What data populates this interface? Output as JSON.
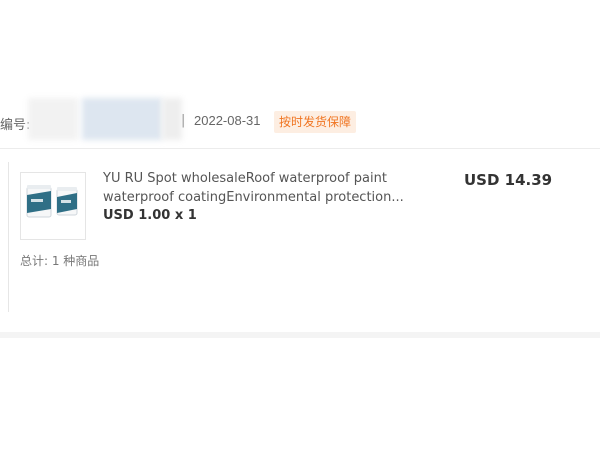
{
  "order": {
    "number_label": "编号:",
    "separator": "|",
    "date": "2022-08-31",
    "badge": "按时发货保障",
    "total": "USD 14.39",
    "items_count": "总计: 1 种商品"
  },
  "product": {
    "title": "YU RU Spot wholesaleRoof waterproof paint waterproof coatingEnvironmental protection...",
    "price_qty": "USD 1.00 x 1",
    "thumb_icon": "paint-bucket-icon"
  },
  "colors": {
    "badge_bg": "#fdeee2",
    "badge_text": "#f07522",
    "bucket_teal": "#2f6f86"
  }
}
